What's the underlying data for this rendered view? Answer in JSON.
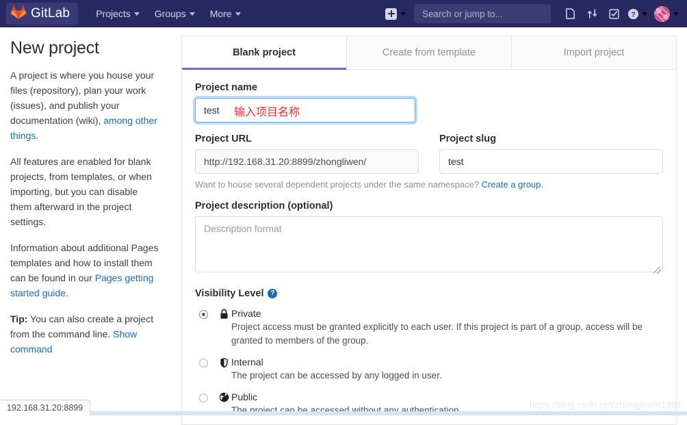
{
  "navbar": {
    "brand_label": "GitLab",
    "brand_icon": "gitlab-fox-logo",
    "links": [
      {
        "label": "Projects",
        "icon": "chevron-down-icon"
      },
      {
        "label": "Groups",
        "icon": "chevron-down-icon"
      },
      {
        "label": "More",
        "icon": "chevron-down-icon"
      }
    ],
    "new_icon": "plus-square-icon",
    "search": {
      "placeholder": "Search or jump to...",
      "value": "",
      "icon": "search-icon"
    },
    "icons": [
      {
        "name": "issues-icon"
      },
      {
        "name": "merge-requests-icon"
      },
      {
        "name": "todos-icon"
      },
      {
        "name": "help-icon"
      }
    ],
    "avatar_icon": "user-avatar"
  },
  "sidebar": {
    "title": "New project",
    "p1_a": "A project is where you house your files (repository), plan your work (issues), and publish your documentation (wiki), ",
    "p1_link": "among other things",
    "p1_b": ".",
    "p2": "All features are enabled for blank projects, from templates, or when importing, but you can disable them afterward in the project settings.",
    "p3_a": "Information about additional Pages templates and how to install them can be found in our ",
    "p3_link": "Pages getting started guide",
    "p3_b": ".",
    "p4_tip": "Tip:",
    "p4_a": " You can also create a project from the command line. ",
    "p4_link": "Show command"
  },
  "tabs": [
    {
      "label": "Blank project",
      "active": true
    },
    {
      "label": "Create from template",
      "active": false
    },
    {
      "label": "Import project",
      "active": false
    }
  ],
  "form": {
    "project_name_label": "Project name",
    "project_name_value": "test",
    "project_name_annotation": "输入项目名称",
    "project_url_label": "Project URL",
    "project_url_value": "http://192.168.31.20:8899/zhongliwen/",
    "project_slug_label": "Project slug",
    "project_slug_value": "test",
    "namespace_hint": "Want to house several dependent projects under the same namespace? ",
    "namespace_link": "Create a group.",
    "description_label": "Project description (optional)",
    "description_value": "",
    "description_placeholder": "Description format",
    "visibility_label": "Visibility Level",
    "visibility_help_icon": "question-circle-icon",
    "visibility_options": [
      {
        "name": "Private",
        "icon": "lock-icon",
        "selected": true,
        "description": "Project access must be granted explicitly to each user. If this project is part of a group, access will be granted to members of the group."
      },
      {
        "name": "Internal",
        "icon": "shield-icon",
        "selected": false,
        "description": "The project can be accessed by any logged in user."
      },
      {
        "name": "Public",
        "icon": "globe-icon",
        "selected": false,
        "description": "The project can be accessed without any authentication."
      }
    ]
  },
  "status_bar": {
    "text": "192.168.31.20:8899"
  },
  "watermark": {
    "text": "https://blog.csdn.net/zhongliwen1981"
  },
  "colors": {
    "navbar_bg": "#292961",
    "accent": "#6b6bcd",
    "link": "#1b69b6",
    "annotation_red": "#ef2d2d"
  }
}
